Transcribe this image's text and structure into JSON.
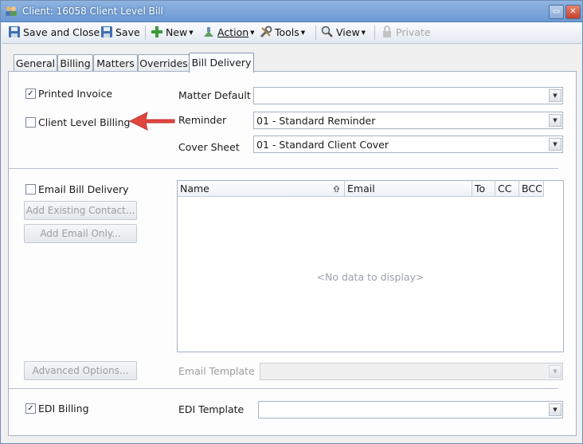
{
  "window": {
    "title": "Client: 16058 Client Level Bill",
    "minimize_glyph": "▭",
    "close_glyph": "✕"
  },
  "toolbar": {
    "save_close_label": "Save and Close",
    "save_label": "Save",
    "new_label": "New",
    "action_label": "Action",
    "tools_label": "Tools",
    "view_label": "View",
    "private_label": "Private",
    "dropdown_glyph": "▼"
  },
  "tabs": [
    {
      "label": "General"
    },
    {
      "label": "Billing"
    },
    {
      "label": "Matters"
    },
    {
      "label": "Overrides"
    },
    {
      "label": "Bill Delivery",
      "active": true
    }
  ],
  "delivery": {
    "printed_invoice": {
      "label": "Printed Invoice",
      "checked": true
    },
    "client_level_billing": {
      "label": "Client Level Billing",
      "checked": false
    },
    "matter_default": {
      "label": "Matter Default",
      "value": ""
    },
    "reminder": {
      "label": "Reminder",
      "value": "01 - Standard Reminder"
    },
    "cover_sheet": {
      "label": "Cover Sheet",
      "value": "01 - Standard Client Cover"
    }
  },
  "email": {
    "email_bill_delivery": {
      "label": "Email Bill Delivery",
      "checked": false
    },
    "add_existing_contact_label": "Add Existing Contact...",
    "add_email_only_label": "Add Email Only...",
    "advanced_options_label": "Advanced Options...",
    "email_template_label": "Email Template",
    "email_template_value": "",
    "columns": [
      "Name",
      "Email",
      "To",
      "CC",
      "BCC"
    ],
    "empty_text": "<No data to display>"
  },
  "edi": {
    "edi_billing": {
      "label": "EDI Billing",
      "checked": true
    },
    "edi_template_label": "EDI Template",
    "edi_template_value": ""
  },
  "colors": {
    "title_bar": "#6b9ad4",
    "arrow": "#e0463f"
  },
  "check_glyph": "✓"
}
